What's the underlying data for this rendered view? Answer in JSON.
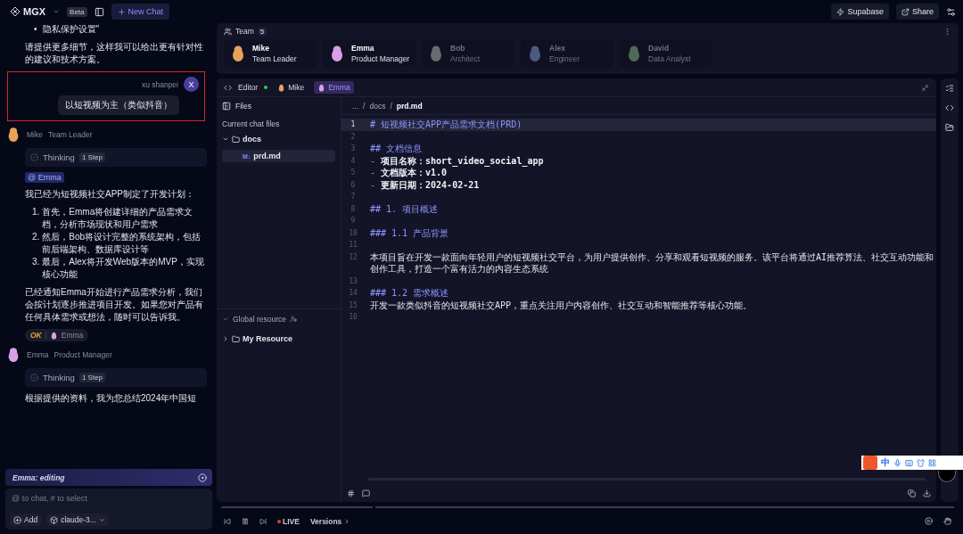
{
  "topbar": {
    "logo": "MGX",
    "badge": "Beta",
    "new_chat": "New Chat",
    "actions": [
      "Supabase",
      "Share"
    ]
  },
  "chat": {
    "blocks": [
      {
        "kind": "bullets",
        "items": [
          {
            "bullet": "•",
            "text": "隐私保护设置\""
          }
        ]
      },
      {
        "kind": "paragraph",
        "text": "请提供更多细节，这样我可以给出更有针对性的建议和技术方案。"
      },
      {
        "kind": "user",
        "name": "xu shanpei",
        "avatar": "X",
        "text": "以短视频为主（类似抖音）",
        "highlighted": true
      },
      {
        "kind": "agent",
        "name": "Mike",
        "role": "Team Leader",
        "color": "#e8a25a"
      },
      {
        "kind": "thinking",
        "label": "Thinking",
        "steps": "1 Step"
      },
      {
        "kind": "mention",
        "text": "@ Emma"
      },
      {
        "kind": "paragraph",
        "text": "我已经为短视频社交APP制定了开发计划："
      },
      {
        "kind": "numbered",
        "items": [
          {
            "number": "1.",
            "text": "首先，Emma将创建详细的产品需求文档，分析市场现状和用户需求"
          },
          {
            "number": "2.",
            "text": "然后，Bob将设计完整的系统架构，包括前后端架构、数据库设计等"
          },
          {
            "number": "3.",
            "text": "最后，Alex将开发Web版本的MVP，实现核心功能"
          }
        ]
      },
      {
        "kind": "paragraph",
        "text": "已经通知Emma开始进行产品需求分析，我们会按计划逐步推进项目开发。如果您对产品有任何具体需求或想法，随时可以告诉我。"
      },
      {
        "kind": "reaction",
        "status": "OK",
        "agent": "Emma",
        "color": "#d9a0e8"
      },
      {
        "kind": "agent",
        "name": "Emma",
        "role": "Product Manager",
        "color": "#d9a0e8"
      },
      {
        "kind": "thinking",
        "label": "Thinking",
        "steps": "1 Step"
      },
      {
        "kind": "paragraph",
        "text": "根据提供的资料，我为您总结2024年中国短"
      }
    ],
    "status_banner": "Emma: editing",
    "composer": {
      "placeholder": "@ to chat, # to select",
      "add": "Add",
      "model": "claude-3..."
    }
  },
  "team": {
    "title": "Team",
    "count": "5",
    "members": [
      {
        "name": "Mike",
        "role": "Team Leader",
        "active": true,
        "color": "#e8a25a"
      },
      {
        "name": "Emma",
        "role": "Product Manager",
        "active": true,
        "color": "#d9a0e8"
      },
      {
        "name": "Bob",
        "role": "Architect",
        "active": false,
        "color": "#6a6a70"
      },
      {
        "name": "Alex",
        "role": "Engineer",
        "active": false,
        "color": "#4a5a80"
      },
      {
        "name": "David",
        "role": "Data Analyst",
        "active": false,
        "color": "#506a58"
      }
    ]
  },
  "editor": {
    "title": "Editor",
    "agents": [
      {
        "name": "Mike",
        "selected": false,
        "color": "#e8a25a"
      },
      {
        "name": "Emma",
        "selected": true,
        "color": "#d9a0e8"
      }
    ],
    "files": {
      "title": "Files",
      "section": "Current chat files",
      "tree": [
        {
          "name": "docs",
          "kind": "folder",
          "expanded": true,
          "children": [
            {
              "name": "prd.md",
              "kind": "markdown",
              "badge": "M↓",
              "selected": true
            }
          ]
        }
      ],
      "global_title": "Global resource",
      "global_tree": [
        {
          "name": "My Resource",
          "kind": "folder",
          "expanded": false
        }
      ]
    },
    "breadcrumb": {
      "separator": "/",
      "parts": [
        "...",
        "docs",
        "prd.md"
      ]
    },
    "lines": [
      {
        "number": "1",
        "kind": "heading",
        "text": "# 短视频社交APP产品需求文档(PRD)",
        "active": true
      },
      {
        "number": "2",
        "kind": "blank",
        "active": false
      },
      {
        "number": "3",
        "kind": "heading",
        "text": "## 文档信息",
        "active": false
      },
      {
        "number": "4",
        "kind": "item",
        "bullet": "-",
        "text": "项目名称：short_video_social_app",
        "active": false
      },
      {
        "number": "5",
        "kind": "item",
        "bullet": "-",
        "text": "文档版本：v1.0",
        "active": false
      },
      {
        "number": "6",
        "kind": "item",
        "bullet": "-",
        "text": "更新日期：2024-02-21",
        "active": false
      },
      {
        "number": "7",
        "kind": "blank",
        "active": false
      },
      {
        "number": "8",
        "kind": "heading",
        "text": "## 1. 项目概述",
        "active": false
      },
      {
        "number": "9",
        "kind": "blank",
        "active": false
      },
      {
        "number": "10",
        "kind": "heading",
        "text": "### 1.1 产品背景",
        "active": false
      },
      {
        "number": "11",
        "kind": "blank",
        "active": false
      },
      {
        "number": "12",
        "kind": "text",
        "text": "本项目旨在开发一款面向年轻用户的短视频社交平台，为用户提供创作、分享和观看短视频的服务。该平台将通过AI推荐算法、社交互动功能和创作工具，打造一个富有活力的内容生态系统",
        "active": false
      },
      {
        "number": "13",
        "kind": "blank",
        "active": false
      },
      {
        "number": "14",
        "kind": "heading",
        "text": "### 1.2 需求概述",
        "active": false
      },
      {
        "number": "15",
        "kind": "text",
        "text": "开发一款类似抖音的短视频社交APP，重点关注用户内容创作、社交互动和智能推荐等核心功能。",
        "active": false
      },
      {
        "number": "16",
        "kind": "blank",
        "active": false
      }
    ]
  },
  "playback": {
    "live": "LIVE",
    "versions": "Versions"
  },
  "ime_toolbar": {
    "label": "中"
  }
}
